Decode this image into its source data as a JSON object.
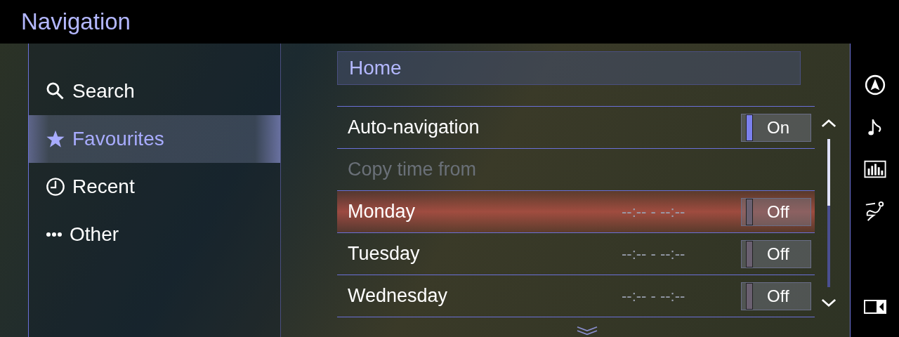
{
  "header": {
    "title": "Navigation"
  },
  "menu": [
    {
      "label": "Search",
      "selected": false
    },
    {
      "label": "Favourites",
      "selected": true
    },
    {
      "label": "Recent",
      "selected": false
    },
    {
      "label": "Other",
      "selected": false
    }
  ],
  "home": {
    "label": "Home"
  },
  "rows": [
    {
      "kind": "toggle",
      "label": "Auto-navigation",
      "state": "On",
      "on": true,
      "selected": false,
      "disabled": false
    },
    {
      "kind": "action",
      "label": "Copy time from",
      "selected": false,
      "disabled": true
    },
    {
      "kind": "day",
      "label": "Monday",
      "time": "--:-- - --:--",
      "state": "Off",
      "on": false,
      "selected": true,
      "disabled": false
    },
    {
      "kind": "day",
      "label": "Tuesday",
      "time": "--:-- - --:--",
      "state": "Off",
      "on": false,
      "selected": false,
      "disabled": false
    },
    {
      "kind": "day",
      "label": "Wednesday",
      "time": "--:-- - --:--",
      "state": "Off",
      "on": false,
      "selected": false,
      "disabled": false
    }
  ]
}
